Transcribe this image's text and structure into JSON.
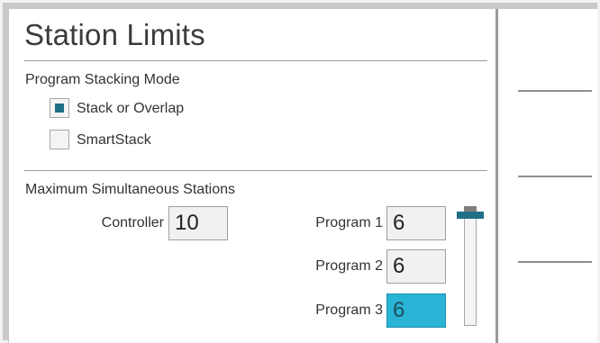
{
  "screen": {
    "title": "Station Limits"
  },
  "stacking": {
    "heading": "Program Stacking Mode",
    "options": [
      {
        "label": "Stack or Overlap",
        "checked": true
      },
      {
        "label": "SmartStack",
        "checked": false
      }
    ]
  },
  "max_stations": {
    "heading": "Maximum Simultaneous Stations",
    "controller": {
      "label": "Controller",
      "value": "10"
    },
    "programs": [
      {
        "label": "Program 1",
        "value": "6",
        "selected": false
      },
      {
        "label": "Program 2",
        "value": "6",
        "selected": false
      },
      {
        "label": "Program 3",
        "value": "6",
        "selected": true
      }
    ]
  },
  "colors": {
    "selected_field": "#29b3d4",
    "checkbox_fill": "#1f6f86",
    "scroll_thumb": "#1f6f86"
  },
  "icons": {
    "scrollbar": "scrollbar-thumb-icon"
  }
}
